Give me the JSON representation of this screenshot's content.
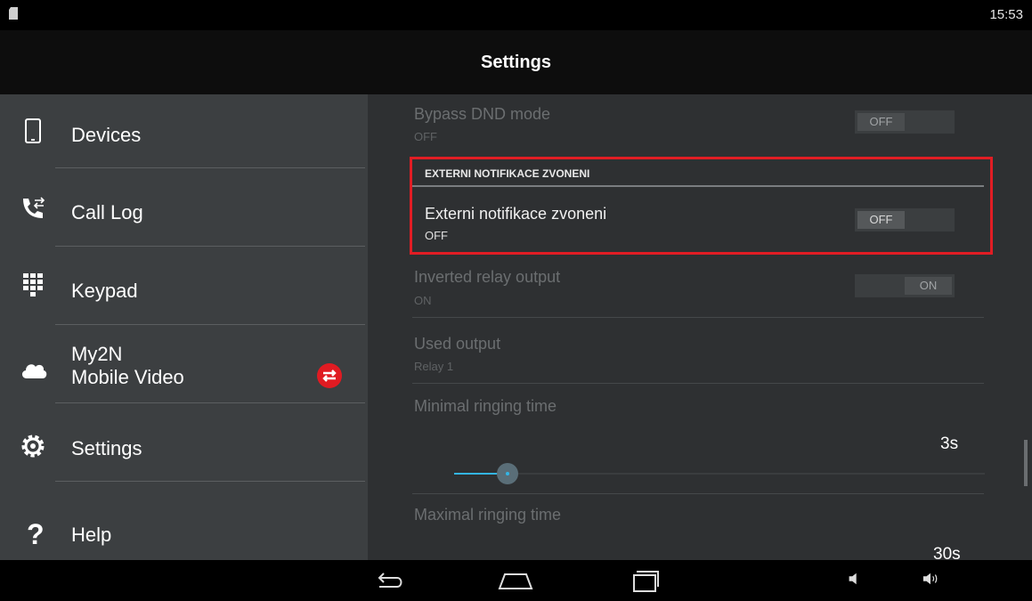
{
  "status_bar": {
    "time": "15:53"
  },
  "header": {
    "title": "Settings"
  },
  "sidebar": {
    "items": [
      {
        "label": "Devices",
        "icon": "phone-icon"
      },
      {
        "label": "Call Log",
        "icon": "call-log-icon"
      },
      {
        "label": "Keypad",
        "icon": "keypad-icon"
      },
      {
        "label_line1": "My2N",
        "label_line2": "Mobile Video",
        "icon": "cloud-icon",
        "badge_icon": "sync-error-icon"
      },
      {
        "label": "Settings",
        "icon": "gear-icon"
      },
      {
        "label": "Help",
        "icon": "help-icon"
      }
    ]
  },
  "settings": {
    "bypass_dnd": {
      "title": "Bypass DND mode",
      "value": "OFF",
      "toggle_label": "OFF"
    },
    "section_header": "EXTERNI NOTIFIKACE ZVONENI",
    "externi_notifikace": {
      "title": "Externi notifikace zvoneni",
      "value": "OFF",
      "toggle_label": "OFF"
    },
    "inverted_relay": {
      "title": "Inverted relay output",
      "value": "ON",
      "toggle_label": "ON"
    },
    "used_output": {
      "title": "Used output",
      "value": "Relay 1"
    },
    "min_ringing": {
      "title": "Minimal ringing time",
      "value": "3s"
    },
    "max_ringing": {
      "title": "Maximal ringing time",
      "value": "30s"
    }
  },
  "colors": {
    "highlight": "#e11d24",
    "slider_accent": "#33b5e5"
  }
}
